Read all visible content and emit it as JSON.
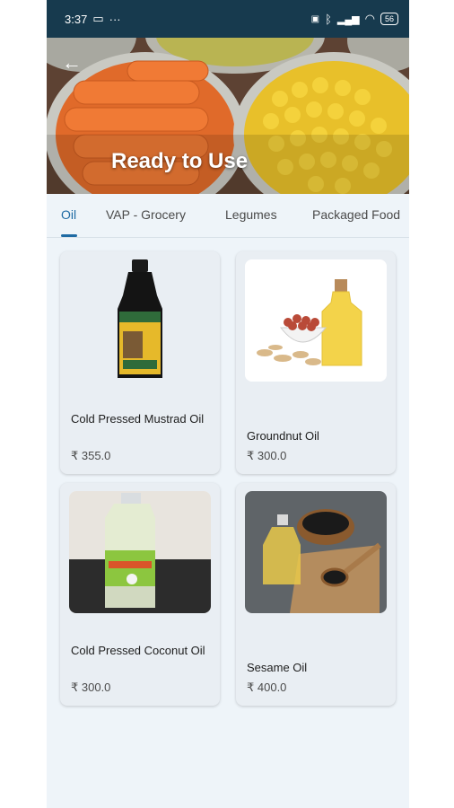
{
  "status": {
    "time": "3:37",
    "extra": "···",
    "battery": "56"
  },
  "header": {
    "title": "Ready to Use"
  },
  "tabs": [
    {
      "label": "Oil"
    },
    {
      "label": "VAP - Grocery"
    },
    {
      "label": "Legumes"
    },
    {
      "label": "Packaged Food"
    }
  ],
  "products": [
    {
      "name": "Cold Pressed Mustrad Oil",
      "price": "₹ 355.0"
    },
    {
      "name": "Groundnut Oil",
      "price": "₹ 300.0"
    },
    {
      "name": "Cold Pressed Coconut Oil",
      "price": "₹ 300.0"
    },
    {
      "name": "Sesame Oil",
      "price": "₹ 400.0"
    }
  ],
  "colors": {
    "accent": "#1e6aa3",
    "status_bar": "#173a4e",
    "background": "#eef4f9"
  }
}
